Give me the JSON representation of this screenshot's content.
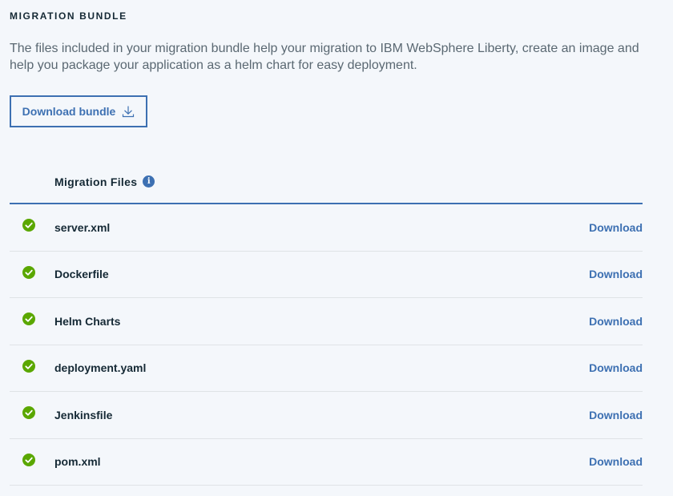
{
  "section": {
    "title": "MIGRATION BUNDLE",
    "description": "The files included in your migration bundle help your migration to IBM WebSphere Liberty, create an image and help you package your application as a helm chart for easy deployment."
  },
  "bundle_button": {
    "label": "Download bundle",
    "icon": "download-icon"
  },
  "files_table": {
    "header": "Migration Files",
    "header_icon": "info-icon",
    "status_icon": "checkmark-circle-icon",
    "status_color": "#5aa700",
    "accent_color": "#3d70b2",
    "rows": [
      {
        "name": "server.xml",
        "action": "Download"
      },
      {
        "name": "Dockerfile",
        "action": "Download"
      },
      {
        "name": "Helm Charts",
        "action": "Download"
      },
      {
        "name": "deployment.yaml",
        "action": "Download"
      },
      {
        "name": "Jenkinsfile",
        "action": "Download"
      },
      {
        "name": "pom.xml",
        "action": "Download"
      }
    ]
  }
}
